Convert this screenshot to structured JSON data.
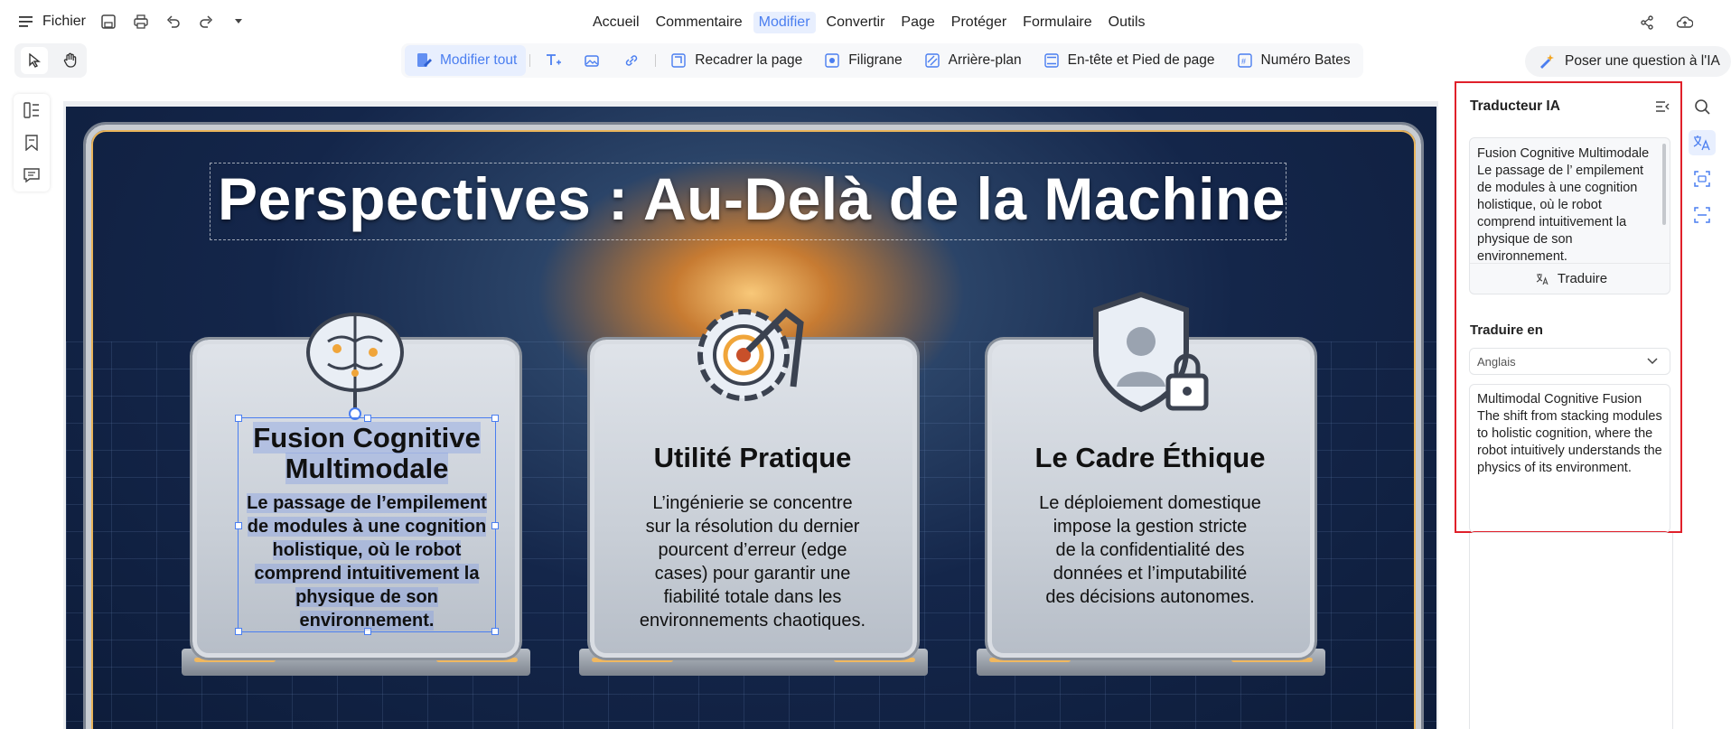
{
  "topbar": {
    "file_label": "Fichier",
    "menu": [
      {
        "label": "Accueil",
        "active": false
      },
      {
        "label": "Commentaire",
        "active": false
      },
      {
        "label": "Modifier",
        "active": true
      },
      {
        "label": "Convertir",
        "active": false
      },
      {
        "label": "Page",
        "active": false
      },
      {
        "label": "Protéger",
        "active": false
      },
      {
        "label": "Formulaire",
        "active": false
      },
      {
        "label": "Outils",
        "active": false
      }
    ]
  },
  "edit_toolbar": {
    "edit_all": "Modifier tout",
    "crop": "Recadrer la page",
    "watermark": "Filigrane",
    "background": "Arrière-plan",
    "header_footer": "En-tête et Pied de page",
    "bates": "Numéro Bates"
  },
  "ask_ai": "Poser une question à l'IA",
  "slide": {
    "title": "Perspectives : Au-Delà de la Machine",
    "cards": [
      {
        "title_line1": "Fusion Cognitive",
        "title_line2": "Multimodale",
        "body": [
          "Le passage de l’empilement",
          "de modules à une cognition",
          "holistique, où le robot",
          "comprend intuitivement la",
          "physique de son",
          "environnement."
        ]
      },
      {
        "title_line1": "Utilité Pratique",
        "body": [
          "L’ingénierie se concentre",
          "sur la résolution du dernier",
          "pourcent d’erreur (edge",
          "cases) pour garantir une",
          "fiabilité totale dans les",
          "environnements chaotiques."
        ]
      },
      {
        "title_line1": "Le Cadre Éthique",
        "body": [
          "Le déploiement domestique",
          "impose la gestion stricte",
          "de la confidentialité des",
          "données et l’imputabilité",
          "des décisions autonomes."
        ]
      }
    ]
  },
  "translator": {
    "title": "Traducteur IA",
    "source_text": "Fusion Cognitive Multimodale\nLe passage de l’ empilement de modules à une cognition holistique, où le robot comprend intuitivement la physique de son environnement.",
    "translate_button": "Traduire",
    "target_label": "Traduire en",
    "target_language": "Anglais",
    "output_text": "Multimodal Cognitive Fusion\nThe shift from stacking modules to holistic cognition, where the robot intuitively understands the physics of its environment."
  },
  "colors": {
    "accent": "#4a7ef0",
    "highlight_border": "#e0202a",
    "gold": "#f0b860"
  }
}
